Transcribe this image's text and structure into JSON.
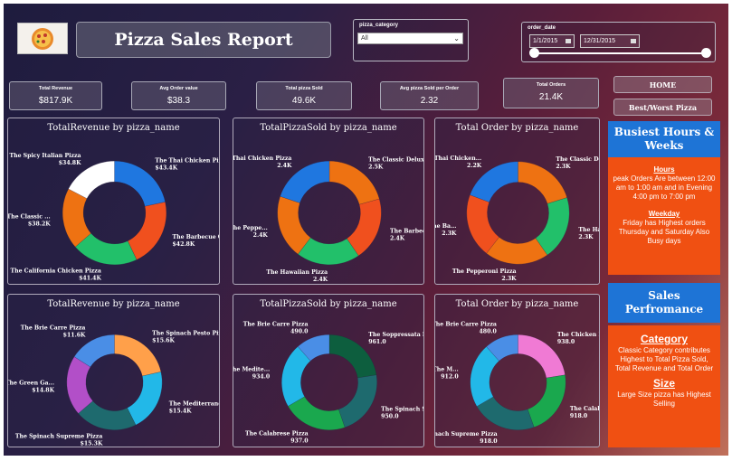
{
  "header": {
    "title": "Pizza Sales Report",
    "logo_icon": "pizza-icon"
  },
  "filters": {
    "category_label": "pizza_category",
    "category_value": "All",
    "date_label": "order_date",
    "date_start": "1/1/2015",
    "date_end": "12/31/2015"
  },
  "kpis": [
    {
      "label": "Total Revenue",
      "value": "$817.9K"
    },
    {
      "label": "Avg Order value",
      "value": "$38.3"
    },
    {
      "label": "Total pizza Sold",
      "value": "49.6K"
    },
    {
      "label": "Avg pizza Sold per Order",
      "value": "2.32"
    },
    {
      "label": "Total Orders",
      "value": "21.4K"
    }
  ],
  "nav": {
    "home": "HOME",
    "best_worst": "Best/Worst Pizza"
  },
  "insights": {
    "busiest_title": "Busiest Hours & Weeks",
    "hours_head": "Hours",
    "hours_text": "peak Orders Are between 12:00 am to 1:00 am and in Evening 4:00 pm to 7:00 pm",
    "weekday_head": "Weekday",
    "weekday_text": "Friday has Highest orders Thursday and Saturday Also Busy days",
    "sales_title": "Sales Perfromance",
    "category_head": "Category",
    "category_text": "Classic Category contributes Highest to Total Pizza Sold, Total Revenue and Total Order",
    "size_head": "Size",
    "size_text": "Large Size pizza has Highest Selling"
  },
  "chart_data": [
    {
      "type": "pie",
      "donut": true,
      "title": "TotalRevenue by pizza_name",
      "slices": [
        {
          "label": "The Thai Chicken Pizza",
          "value_label": "$43.4K",
          "value": 43.4,
          "color": "#1f77e0"
        },
        {
          "label": "The Barbecue Ch...",
          "value_label": "$42.8K",
          "value": 42.8,
          "color": "#f0501e"
        },
        {
          "label": "The California Chicken Pizza",
          "value_label": "$41.4K",
          "value": 41.4,
          "color": "#22c06a"
        },
        {
          "label": "The Classic ...",
          "value_label": "$38.2K",
          "value": 38.2,
          "color": "#ee7212"
        },
        {
          "label": "The Spicy Italian Pizza",
          "value_label": "$34.8K",
          "value": 34.8,
          "color": "#ffffff"
        }
      ]
    },
    {
      "type": "pie",
      "donut": true,
      "title": "TotalPizzaSold by pizza_name",
      "slices": [
        {
          "label": "The Classic Deluxe Pi...",
          "value_label": "2.5K",
          "value": 2.5,
          "color": "#ee7212"
        },
        {
          "label": "The Barbec...",
          "value_label": "2.4K",
          "value": 2.4,
          "color": "#f0501e"
        },
        {
          "label": "The Hawaiian Pizza",
          "value_label": "2.4K",
          "value": 2.4,
          "color": "#22c06a"
        },
        {
          "label": "The Peppe...",
          "value_label": "2.4K",
          "value": 2.4,
          "color": "#ee7212"
        },
        {
          "label": "The Thai Chicken Pizza",
          "value_label": "2.4K",
          "value": 2.4,
          "color": "#1f77e0"
        }
      ]
    },
    {
      "type": "pie",
      "donut": true,
      "title": "Total Order by pizza_name",
      "slices": [
        {
          "label": "The Classic Delux...",
          "value_label": "2.3K",
          "value": 2.3,
          "color": "#ee7212"
        },
        {
          "label": "The Ha...",
          "value_label": "2.3K",
          "value": 2.3,
          "color": "#22c06a"
        },
        {
          "label": "The Pepperoni Pizza",
          "value_label": "2.3K",
          "value": 2.3,
          "color": "#ee7212"
        },
        {
          "label": "The Ba...",
          "value_label": "2.3K",
          "value": 2.3,
          "color": "#f0501e"
        },
        {
          "label": "The Thai Chicken...",
          "value_label": "2.2K",
          "value": 2.2,
          "color": "#1f77e0"
        }
      ]
    },
    {
      "type": "pie",
      "donut": true,
      "title": "TotalRevenue by pizza_name",
      "slices": [
        {
          "label": "The Spinach Pesto Pizza",
          "value_label": "$15.6K",
          "value": 15.6,
          "color": "#ffa04a"
        },
        {
          "label": "The Mediterranean...",
          "value_label": "$15.4K",
          "value": 15.4,
          "color": "#22b8e8"
        },
        {
          "label": "The Spinach Supreme Pizza",
          "value_label": "$15.3K",
          "value": 15.3,
          "color": "#1e6a6e"
        },
        {
          "label": "The Green Ga...",
          "value_label": "$14.8K",
          "value": 14.8,
          "color": "#b24fc8"
        },
        {
          "label": "The Brie Carre Pizza",
          "value_label": "$11.6K",
          "value": 11.6,
          "color": "#4a8ee6"
        }
      ]
    },
    {
      "type": "pie",
      "donut": true,
      "title": "TotalPizzaSold by pizza_name",
      "slices": [
        {
          "label": "The Soppressata Pizza",
          "value_label": "961.0",
          "value": 961,
          "color": "#0d5e3e"
        },
        {
          "label": "The Spinach Su...",
          "value_label": "950.0",
          "value": 950,
          "color": "#1e6a6e"
        },
        {
          "label": "The Calabrese Pizza",
          "value_label": "937.0",
          "value": 937,
          "color": "#1aa84e"
        },
        {
          "label": "The Medite...",
          "value_label": "934.0",
          "value": 934,
          "color": "#22b8e8"
        },
        {
          "label": "The Brie Carre Pizza",
          "value_label": "490.0",
          "value": 490,
          "color": "#4a8ee6"
        }
      ]
    },
    {
      "type": "pie",
      "donut": true,
      "title": "Total Order by pizza_name",
      "slices": [
        {
          "label": "The Chicken Pest...",
          "value_label": "938.0",
          "value": 938,
          "color": "#f07ad4"
        },
        {
          "label": "The Calabre...",
          "value_label": "918.0",
          "value": 918,
          "color": "#1aa84e"
        },
        {
          "label": "The Spinach Supreme Pizza",
          "value_label": "918.0",
          "value": 918,
          "color": "#1e6a6e"
        },
        {
          "label": "The M...",
          "value_label": "912.0",
          "value": 912,
          "color": "#22b8e8"
        },
        {
          "label": "The Brie Carre Pizza",
          "value_label": "480.0",
          "value": 480,
          "color": "#4a8ee6"
        }
      ]
    }
  ]
}
